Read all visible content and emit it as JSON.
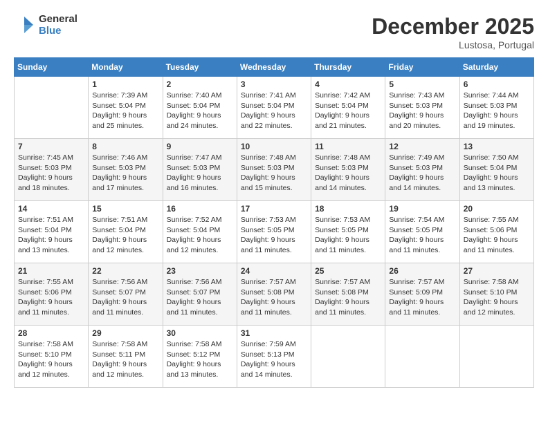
{
  "header": {
    "logo": {
      "line1": "General",
      "line2": "Blue"
    },
    "title": "December 2025",
    "subtitle": "Lustosa, Portugal"
  },
  "days_of_week": [
    "Sunday",
    "Monday",
    "Tuesday",
    "Wednesday",
    "Thursday",
    "Friday",
    "Saturday"
  ],
  "weeks": [
    [
      {
        "day": "",
        "info": ""
      },
      {
        "day": "1",
        "info": "Sunrise: 7:39 AM\nSunset: 5:04 PM\nDaylight: 9 hours\nand 25 minutes."
      },
      {
        "day": "2",
        "info": "Sunrise: 7:40 AM\nSunset: 5:04 PM\nDaylight: 9 hours\nand 24 minutes."
      },
      {
        "day": "3",
        "info": "Sunrise: 7:41 AM\nSunset: 5:04 PM\nDaylight: 9 hours\nand 22 minutes."
      },
      {
        "day": "4",
        "info": "Sunrise: 7:42 AM\nSunset: 5:04 PM\nDaylight: 9 hours\nand 21 minutes."
      },
      {
        "day": "5",
        "info": "Sunrise: 7:43 AM\nSunset: 5:03 PM\nDaylight: 9 hours\nand 20 minutes."
      },
      {
        "day": "6",
        "info": "Sunrise: 7:44 AM\nSunset: 5:03 PM\nDaylight: 9 hours\nand 19 minutes."
      }
    ],
    [
      {
        "day": "7",
        "info": "Sunrise: 7:45 AM\nSunset: 5:03 PM\nDaylight: 9 hours\nand 18 minutes."
      },
      {
        "day": "8",
        "info": "Sunrise: 7:46 AM\nSunset: 5:03 PM\nDaylight: 9 hours\nand 17 minutes."
      },
      {
        "day": "9",
        "info": "Sunrise: 7:47 AM\nSunset: 5:03 PM\nDaylight: 9 hours\nand 16 minutes."
      },
      {
        "day": "10",
        "info": "Sunrise: 7:48 AM\nSunset: 5:03 PM\nDaylight: 9 hours\nand 15 minutes."
      },
      {
        "day": "11",
        "info": "Sunrise: 7:48 AM\nSunset: 5:03 PM\nDaylight: 9 hours\nand 14 minutes."
      },
      {
        "day": "12",
        "info": "Sunrise: 7:49 AM\nSunset: 5:03 PM\nDaylight: 9 hours\nand 14 minutes."
      },
      {
        "day": "13",
        "info": "Sunrise: 7:50 AM\nSunset: 5:04 PM\nDaylight: 9 hours\nand 13 minutes."
      }
    ],
    [
      {
        "day": "14",
        "info": "Sunrise: 7:51 AM\nSunset: 5:04 PM\nDaylight: 9 hours\nand 13 minutes."
      },
      {
        "day": "15",
        "info": "Sunrise: 7:51 AM\nSunset: 5:04 PM\nDaylight: 9 hours\nand 12 minutes."
      },
      {
        "day": "16",
        "info": "Sunrise: 7:52 AM\nSunset: 5:04 PM\nDaylight: 9 hours\nand 12 minutes."
      },
      {
        "day": "17",
        "info": "Sunrise: 7:53 AM\nSunset: 5:05 PM\nDaylight: 9 hours\nand 11 minutes."
      },
      {
        "day": "18",
        "info": "Sunrise: 7:53 AM\nSunset: 5:05 PM\nDaylight: 9 hours\nand 11 minutes."
      },
      {
        "day": "19",
        "info": "Sunrise: 7:54 AM\nSunset: 5:05 PM\nDaylight: 9 hours\nand 11 minutes."
      },
      {
        "day": "20",
        "info": "Sunrise: 7:55 AM\nSunset: 5:06 PM\nDaylight: 9 hours\nand 11 minutes."
      }
    ],
    [
      {
        "day": "21",
        "info": "Sunrise: 7:55 AM\nSunset: 5:06 PM\nDaylight: 9 hours\nand 11 minutes."
      },
      {
        "day": "22",
        "info": "Sunrise: 7:56 AM\nSunset: 5:07 PM\nDaylight: 9 hours\nand 11 minutes."
      },
      {
        "day": "23",
        "info": "Sunrise: 7:56 AM\nSunset: 5:07 PM\nDaylight: 9 hours\nand 11 minutes."
      },
      {
        "day": "24",
        "info": "Sunrise: 7:57 AM\nSunset: 5:08 PM\nDaylight: 9 hours\nand 11 minutes."
      },
      {
        "day": "25",
        "info": "Sunrise: 7:57 AM\nSunset: 5:08 PM\nDaylight: 9 hours\nand 11 minutes."
      },
      {
        "day": "26",
        "info": "Sunrise: 7:57 AM\nSunset: 5:09 PM\nDaylight: 9 hours\nand 11 minutes."
      },
      {
        "day": "27",
        "info": "Sunrise: 7:58 AM\nSunset: 5:10 PM\nDaylight: 9 hours\nand 12 minutes."
      }
    ],
    [
      {
        "day": "28",
        "info": "Sunrise: 7:58 AM\nSunset: 5:10 PM\nDaylight: 9 hours\nand 12 minutes."
      },
      {
        "day": "29",
        "info": "Sunrise: 7:58 AM\nSunset: 5:11 PM\nDaylight: 9 hours\nand 12 minutes."
      },
      {
        "day": "30",
        "info": "Sunrise: 7:58 AM\nSunset: 5:12 PM\nDaylight: 9 hours\nand 13 minutes."
      },
      {
        "day": "31",
        "info": "Sunrise: 7:59 AM\nSunset: 5:13 PM\nDaylight: 9 hours\nand 14 minutes."
      },
      {
        "day": "",
        "info": ""
      },
      {
        "day": "",
        "info": ""
      },
      {
        "day": "",
        "info": ""
      }
    ]
  ]
}
